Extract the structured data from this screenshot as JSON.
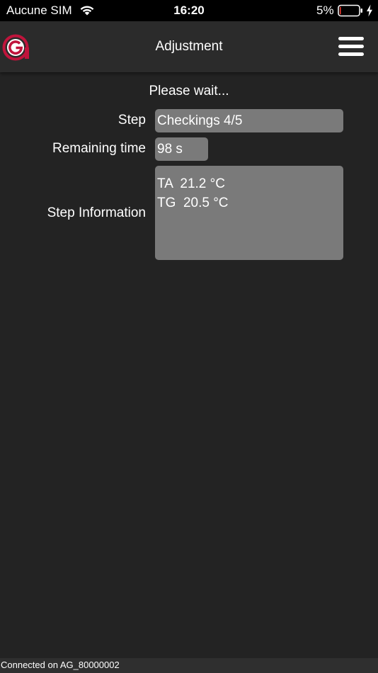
{
  "status_bar": {
    "carrier": "Aucune SIM",
    "time": "16:20",
    "battery_percent": "5%",
    "battery_level": 0.05,
    "battery_color": "#ff3b30",
    "icons": [
      "wifi-icon",
      "battery-icon",
      "charging-bolt-icon"
    ]
  },
  "header": {
    "logo": "app-logo-icon",
    "title": "Adjustment",
    "menu_icon": "hamburger-menu-icon"
  },
  "main": {
    "wait_message": "Please wait...",
    "step": {
      "label": "Step",
      "value": "Checkings 4/5"
    },
    "remaining_time": {
      "label": "Remaining time",
      "value": "98 s"
    },
    "step_information": {
      "label": "Step Information",
      "lines": [
        "TA  21.2 °C",
        "TG  20.5 °C"
      ]
    }
  },
  "footer": {
    "connection_text": "Connected on AG_80000002"
  },
  "colors": {
    "background": "#232323",
    "header": "#2b2b2b",
    "field": "#7a7a7a",
    "logo_red": "#c0143c"
  }
}
